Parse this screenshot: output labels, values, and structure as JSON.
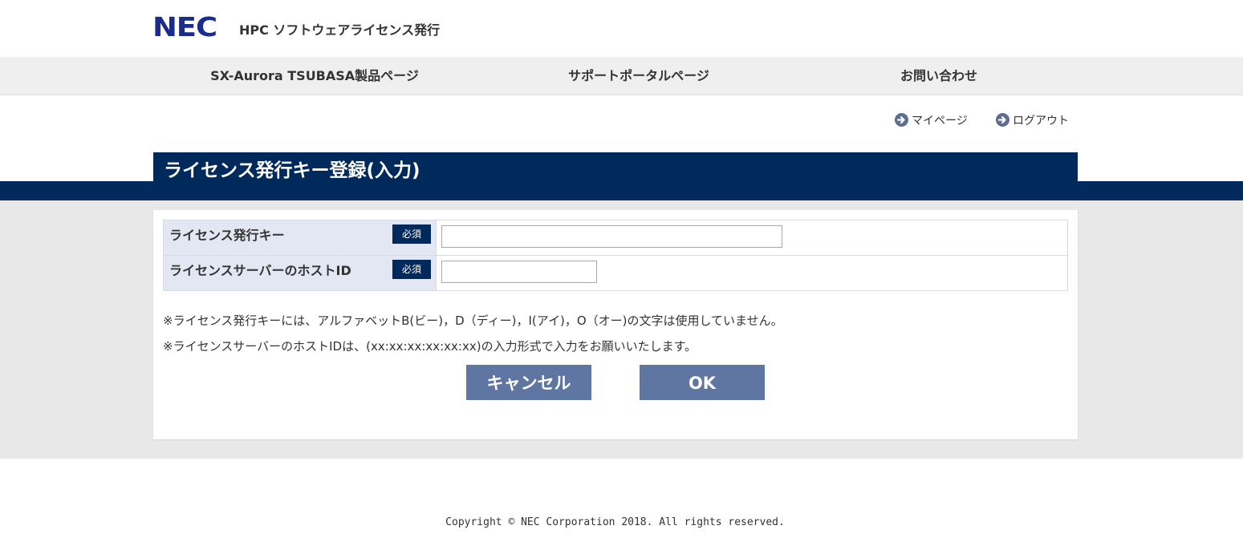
{
  "header": {
    "logo_text": "NEC",
    "site_title": "HPC ソフトウェアライセンス発行"
  },
  "nav": {
    "items": [
      {
        "label": "SX-Aurora TSUBASA製品ページ"
      },
      {
        "label": "サポートポータルページ"
      },
      {
        "label": "お問い合わせ"
      }
    ]
  },
  "user_links": {
    "mypage": "マイページ",
    "logout": "ログアウト"
  },
  "page": {
    "title": "ライセンス発行キー登録(入力)"
  },
  "form": {
    "rows": [
      {
        "label": "ライセンス発行キー",
        "required": "必須",
        "value": "",
        "placeholder": ""
      },
      {
        "label": "ライセンスサーバーのホストID",
        "required": "必須",
        "value": "",
        "placeholder": ""
      }
    ],
    "notes": [
      "※ライセンス発行キーには、アルファベットB(ビー)，D（ディー)，I(アイ)，O（オー)の文字は使用していません。",
      "※ライセンスサーバーのホストIDは、(xx:xx:xx:xx:xx:xx)の入力形式で入力をお願いいたします。"
    ],
    "cancel_label": "キャンセル",
    "ok_label": "OK"
  },
  "footer": {
    "copyright": "Copyright © NEC Corporation 2018. All rights reserved."
  },
  "colors": {
    "brand_blue": "#1a2c8c",
    "navy": "#002a5c",
    "button": "#5e76a1",
    "label_bg": "#e3e7f3",
    "band_gray": "#e8e8e8",
    "nav_bg": "#efefef"
  },
  "icons": {
    "user_link_icon": "circle-arrow-right-icon"
  }
}
